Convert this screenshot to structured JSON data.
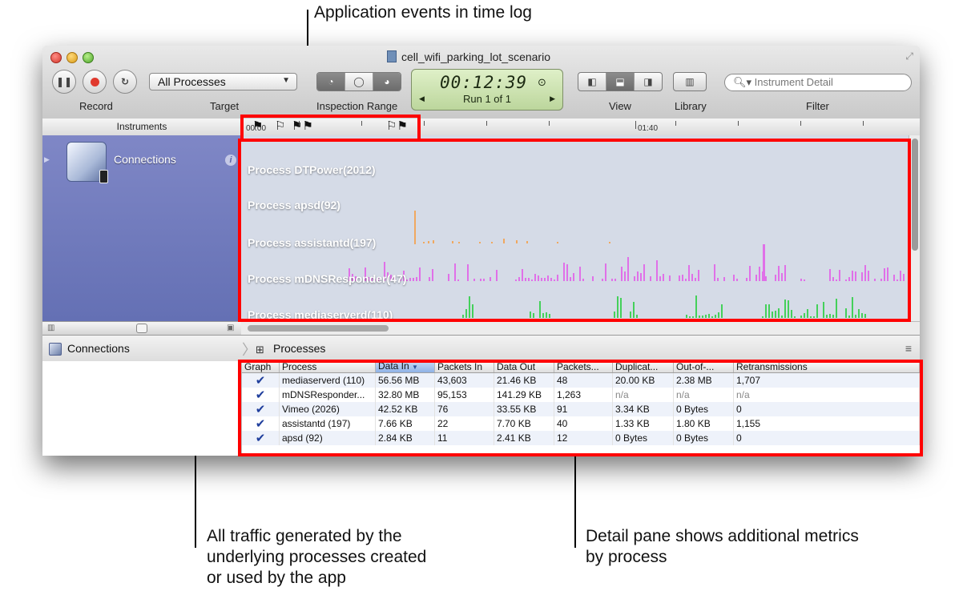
{
  "callouts": {
    "top": "Application events in time log",
    "left": [
      "All traffic generated by the",
      "underlying processes created",
      "or used by the app"
    ],
    "right": [
      "Detail pane shows additional metrics",
      "by process"
    ]
  },
  "window": {
    "title": "cell_wifi_parking_lot_scenario"
  },
  "toolbar": {
    "record_label": "Record",
    "target_label": "Target",
    "target_value": "All Processes",
    "inspection_label": "Inspection Range",
    "time": "00:12:39",
    "run": "Run 1 of 1",
    "view_label": "View",
    "library_label": "Library",
    "filter_label": "Filter",
    "search_placeholder": "Instrument Detail"
  },
  "ruler": {
    "instruments_header": "Instruments",
    "start_label": "00:00",
    "mid_label": "01:40"
  },
  "instrument": {
    "name": "Connections"
  },
  "track_processes": [
    "Process DTPower(2012)",
    "Process apsd(92)",
    "Process assistantd(197)",
    "Process mDNSResponder(47)",
    "Process mediaserverd(110)"
  ],
  "lower": {
    "left_label": "Connections",
    "tab_label": "Processes"
  },
  "table": {
    "headers": [
      "Graph",
      "Process",
      "Data In",
      "Packets In",
      "Data Out",
      "Packets...",
      "Duplicat...",
      "Out-of-...",
      "Retransmissions"
    ],
    "rows": [
      [
        "mediaserverd (110)",
        "56.56 MB",
        "43,603",
        "21.46 KB",
        "48",
        "20.00 KB",
        "2.38 MB",
        "1,707"
      ],
      [
        "mDNSResponder...",
        "32.80 MB",
        "95,153",
        "141.29 KB",
        "1,263",
        "n/a",
        "n/a",
        "n/a"
      ],
      [
        "Vimeo (2026)",
        "42.52 KB",
        "76",
        "33.55 KB",
        "91",
        "3.34 KB",
        "0 Bytes",
        "0"
      ],
      [
        "assistantd (197)",
        "7.66 KB",
        "22",
        "7.70 KB",
        "40",
        "1.33 KB",
        "1.80 KB",
        "1,155"
      ],
      [
        "apsd (92)",
        "2.84 KB",
        "11",
        "2.41 KB",
        "12",
        "0 Bytes",
        "0 Bytes",
        "0"
      ]
    ]
  },
  "colors": {
    "highlight": "#ff0000",
    "orange_series": "#f0a860",
    "pink_series": "#e070e8",
    "green_series": "#44d05a"
  }
}
